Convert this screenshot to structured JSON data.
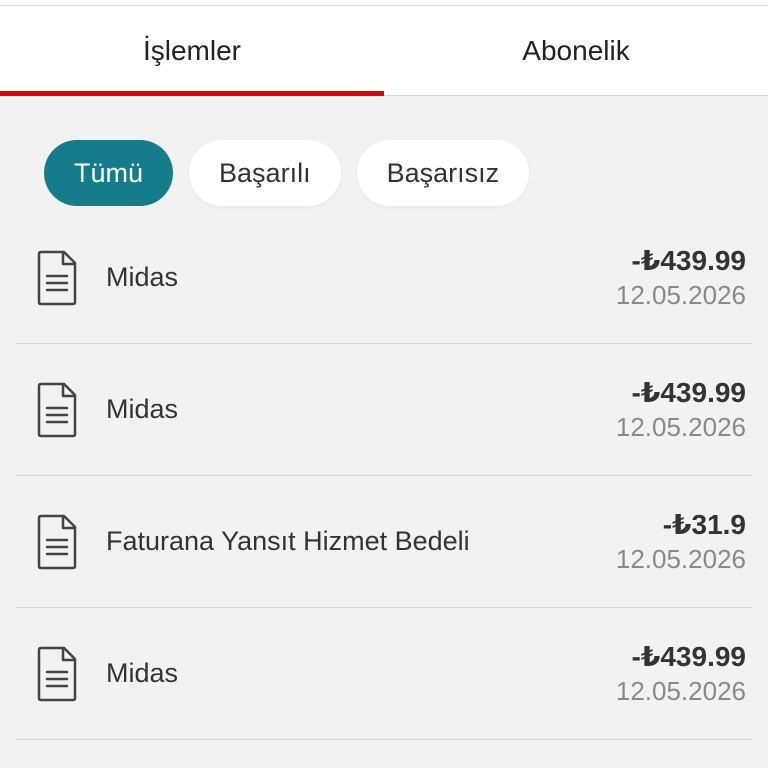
{
  "tabs": [
    {
      "label": "İşlemler",
      "active": true
    },
    {
      "label": "Abonelik",
      "active": false
    }
  ],
  "filters": [
    {
      "label": "Tümü",
      "selected": true
    },
    {
      "label": "Başarılı",
      "selected": false
    },
    {
      "label": "Başarısız",
      "selected": false
    }
  ],
  "transactions": [
    {
      "icon": "document-icon",
      "title": "Midas",
      "amount": "-₺439.99",
      "date": "12.05.2026"
    },
    {
      "icon": "document-icon",
      "title": "Midas",
      "amount": "-₺439.99",
      "date": "12.05.2026"
    },
    {
      "icon": "document-icon",
      "title": "Faturana Yansıt Hizmet Bedeli",
      "amount": "-₺31.9",
      "date": "12.05.2026"
    },
    {
      "icon": "document-icon",
      "title": "Midas",
      "amount": "-₺439.99",
      "date": "12.05.2026"
    }
  ],
  "colors": {
    "accent_red": "#e60000",
    "chip_selected": "#147c8a",
    "background": "#f2f2f2"
  }
}
